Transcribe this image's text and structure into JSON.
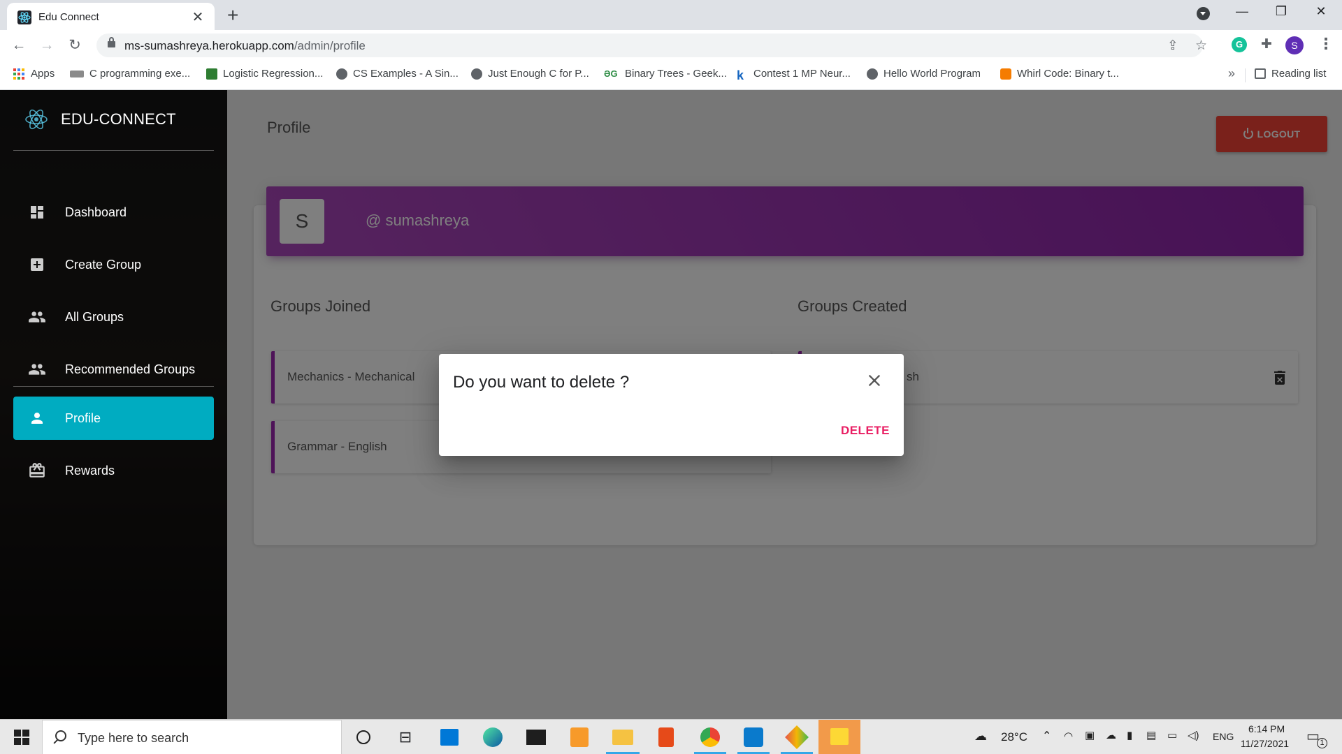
{
  "browser": {
    "tab_title": "Edu Connect",
    "tab_close": "✕",
    "new_tab": "+",
    "url_host": "ms-sumashreya.herokuapp.com",
    "url_path": "/admin/profile",
    "profile_initial": "S",
    "window_minimize": "—",
    "window_restore": "❐",
    "window_close": "✕"
  },
  "bookmarks": {
    "apps": "Apps",
    "items": [
      {
        "label": "C programming exe...",
        "icon_color": "#8a8a8a"
      },
      {
        "label": "Logistic Regression...",
        "icon_color": "#2e7d32"
      },
      {
        "label": "CS Examples - A Sin...",
        "icon_color": "#5f6368"
      },
      {
        "label": "Just Enough C for P...",
        "icon_color": "#5f6368"
      },
      {
        "label": "Binary Trees - Geek...",
        "icon_color": "#2f8d46"
      },
      {
        "label": "Contest 1 MP Neur...",
        "icon_color": "#1565c0"
      },
      {
        "label": "Hello World Program",
        "icon_color": "#5f6368"
      },
      {
        "label": "Whirl Code: Binary t...",
        "icon_color": "#f57c00"
      }
    ],
    "more": "»",
    "reading_list": "Reading list"
  },
  "sidebar": {
    "brand": "EDU-CONNECT",
    "items": [
      {
        "label": "Dashboard",
        "icon": "dashboard-icon",
        "active": false
      },
      {
        "label": "Create Group",
        "icon": "add-box-icon",
        "active": false
      },
      {
        "label": "All Groups",
        "icon": "people-icon",
        "active": false
      },
      {
        "label": "Recommended Groups",
        "icon": "people-icon",
        "active": false
      },
      {
        "label": "Profile",
        "icon": "person-icon",
        "active": true
      },
      {
        "label": "Rewards",
        "icon": "redeem-icon",
        "active": false
      }
    ]
  },
  "main": {
    "page_title": "Profile",
    "logout_label": "LOGOUT",
    "avatar_initial": "S",
    "username": "@ sumashreya",
    "groups_joined_title": "Groups Joined",
    "groups_created_title": "Groups Created",
    "groups_joined": [
      "Mechanics - Mechanical",
      "Grammar - English"
    ],
    "groups_created_visible_fragment": "sh"
  },
  "dialog": {
    "title": "Do you want to delete ?",
    "delete_label": "DELETE"
  },
  "taskbar": {
    "search_placeholder": "Type here to search",
    "weather": "28°C",
    "language": "ENG",
    "time": "6:14 PM",
    "date": "11/27/2021",
    "notifications": "1"
  },
  "colors": {
    "accent_cyan": "#00acc1",
    "header_purple": "#8e24aa",
    "logout_red": "#f44336",
    "delete_pink": "#e91e63"
  }
}
